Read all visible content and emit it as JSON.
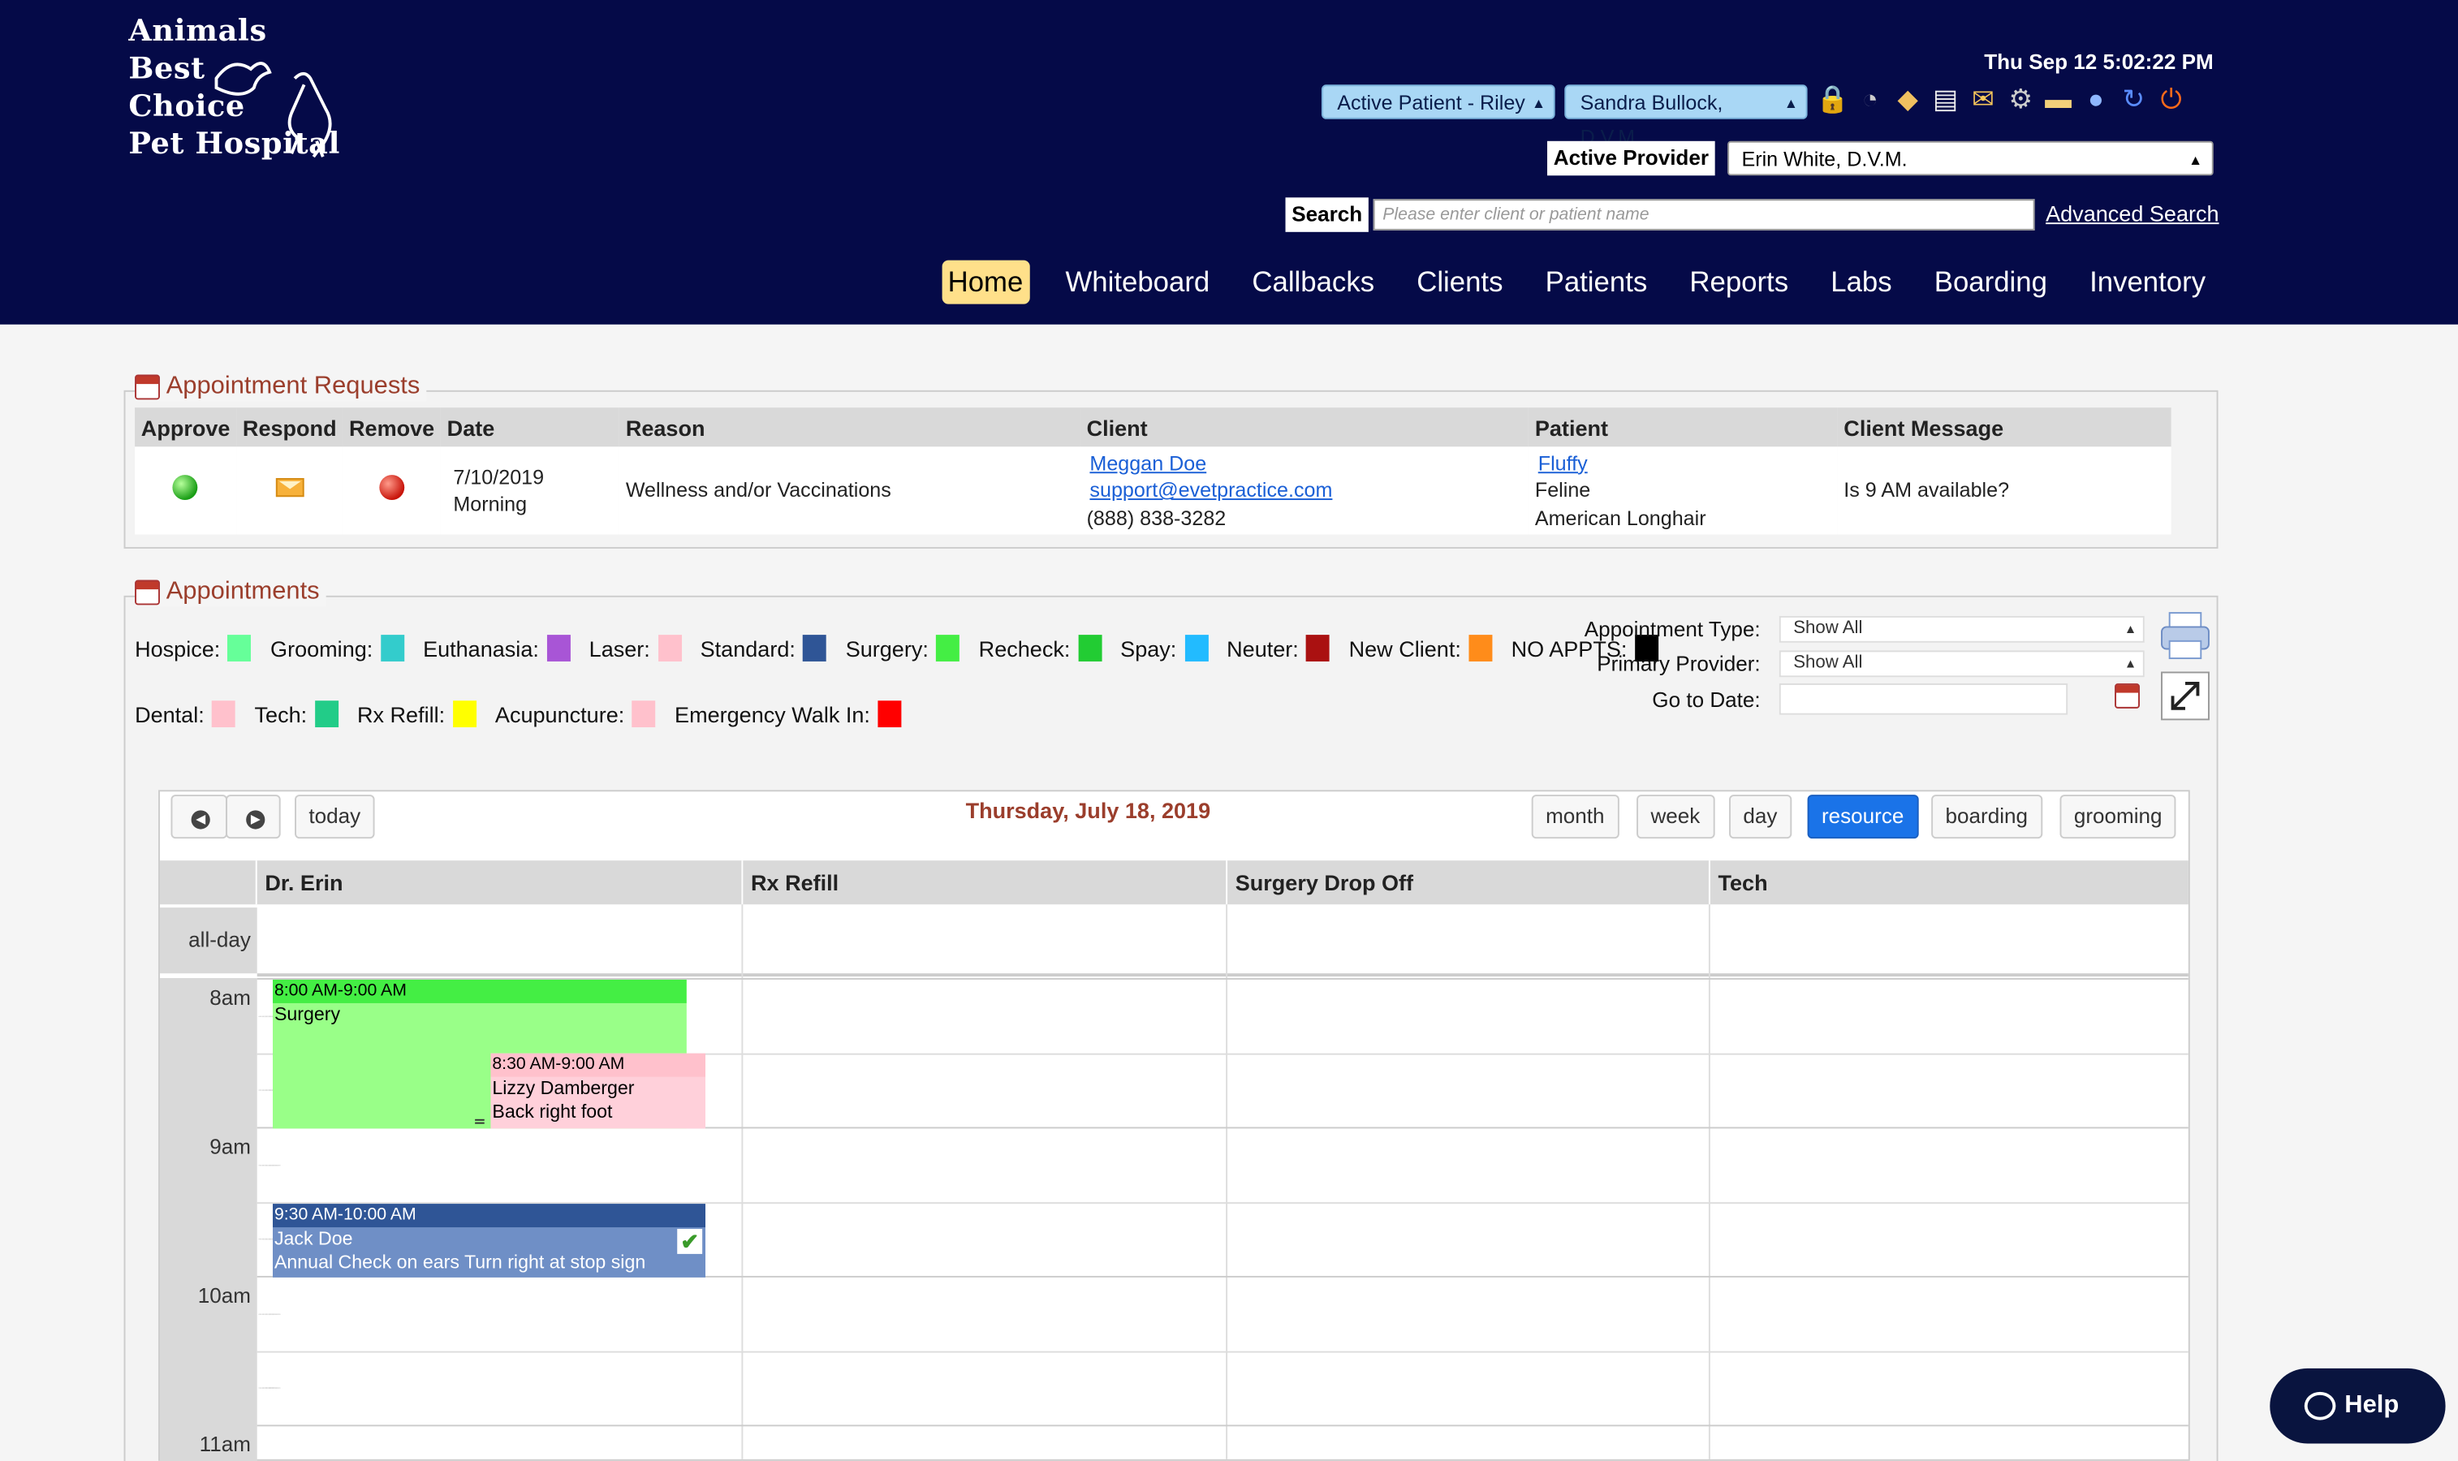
{
  "brand": {
    "line1": "Animals",
    "line2": "Best",
    "line3": "Choice",
    "line4": "Pet Hospital"
  },
  "header": {
    "datetime": "Thu Sep 12 5:02:22 PM",
    "active_patient": "Active Patient - Riley",
    "doctor": "Sandra Bullock, D.V.M",
    "active_provider_label": "Active Provider",
    "active_provider_value": "Erin White, D.V.M.",
    "search_label": "Search",
    "search_placeholder": "Please enter client or patient name",
    "advanced_search": "Advanced Search",
    "toolbar_icons": [
      "lock-icon",
      "clock-icon",
      "tag-icon",
      "document-icon",
      "mail-icon",
      "gear-icon",
      "chat-icon",
      "help-icon",
      "refresh-icon",
      "power-icon"
    ]
  },
  "nav": {
    "items": [
      "Home",
      "Whiteboard",
      "Callbacks",
      "Clients",
      "Patients",
      "Reports",
      "Labs",
      "Boarding",
      "Inventory"
    ],
    "active": "Home"
  },
  "requests": {
    "title": "Appointment Requests",
    "columns": [
      "Approve",
      "Respond",
      "Remove",
      "Date",
      "Reason",
      "Client",
      "Patient",
      "Client Message"
    ],
    "row": {
      "date": "7/10/2019",
      "time": "Morning",
      "reason": "Wellness and/or Vaccinations",
      "client_name": "Meggan Doe",
      "client_email": "support@evetpractice.com",
      "client_phone": "(888) 838-3282",
      "patient_name": "Fluffy",
      "patient_species": "Feline",
      "patient_breed": "American Longhair",
      "message": "Is 9 AM available?"
    }
  },
  "appointments": {
    "title": "Appointments",
    "legend_row1": [
      {
        "label": "Hospice:",
        "color": "#66ff99"
      },
      {
        "label": "Grooming:",
        "color": "#33cccc"
      },
      {
        "label": "Euthanasia:",
        "color": "#a855d6"
      },
      {
        "label": "Laser:",
        "color": "#ffc1cc"
      },
      {
        "label": "Standard:",
        "color": "#2f5596"
      },
      {
        "label": "Surgery:",
        "color": "#44ee44"
      },
      {
        "label": "Recheck:",
        "color": "#22cc33"
      },
      {
        "label": "Spay:",
        "color": "#22bbff"
      },
      {
        "label": "Neuter:",
        "color": "#aa1111"
      },
      {
        "label": "New Client:",
        "color": "#ff8c1a"
      },
      {
        "label": "NO APPTS:",
        "color": "#000000"
      }
    ],
    "legend_row2": [
      {
        "label": "Dental:",
        "color": "#ffc1cc"
      },
      {
        "label": "Tech:",
        "color": "#22cc88"
      },
      {
        "label": "Rx Refill:",
        "color": "#ffff00"
      },
      {
        "label": "Acupuncture:",
        "color": "#ffc1cc"
      },
      {
        "label": "Emergency Walk In:",
        "color": "#ff0000"
      }
    ],
    "appointment_type_label": "Appointment Type:",
    "appointment_type_value": "Show All",
    "primary_provider_label": "Primary Provider:",
    "primary_provider_value": "Show All",
    "goto_label": "Go to Date:",
    "goto_value": ""
  },
  "calendar": {
    "today_btn": "today",
    "title": "Thursday, July 18, 2019",
    "views": [
      "month",
      "week",
      "day",
      "resource",
      "boarding",
      "grooming"
    ],
    "active_view": "resource",
    "columns": [
      "Dr. Erin",
      "Rx Refill",
      "Surgery Drop Off",
      "Tech"
    ],
    "allday_label": "all-day",
    "hours": [
      "8am",
      "9am",
      "10am",
      "11am"
    ],
    "events": [
      {
        "time": "8:00 AM-9:00 AM",
        "line1": "Surgery",
        "line2": "",
        "color": "#99ff88",
        "head": "#44ee44",
        "text": "#000"
      },
      {
        "time": "8:30 AM-9:00 AM",
        "line1": "Lizzy Damberger",
        "line2": "Back right foot",
        "color": "#ffd0da",
        "head": "#ffc1cc",
        "text": "#000"
      },
      {
        "time": "9:30 AM-10:00 AM",
        "line1": "Jack Doe",
        "line2": "Annual Check on ears Turn right at stop sign",
        "color": "#6f8fc6",
        "head": "#2f5596",
        "text": "#fff"
      }
    ]
  },
  "help": {
    "label": "Help"
  }
}
